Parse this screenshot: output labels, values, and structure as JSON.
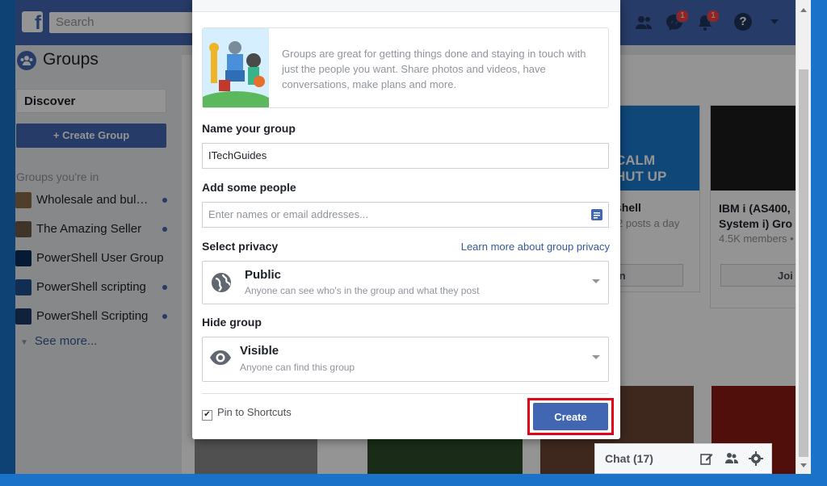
{
  "header": {
    "logo_letter": "f",
    "search_placeholder": "Search",
    "messages_badge": "1",
    "notifications_badge": "1",
    "help_glyph": "?"
  },
  "left": {
    "title": "Groups",
    "discover": "Discover",
    "create_group": "+ Create Group",
    "groups_heading": "Groups you're in",
    "groups": [
      {
        "label": "Wholesale and bulk ..."
      },
      {
        "label": "The Amazing Seller"
      },
      {
        "label": "PowerShell User Group"
      },
      {
        "label": "PowerShell scripting"
      },
      {
        "label": "PowerShell Scripting"
      }
    ],
    "see_more": "See more..."
  },
  "background_cards": {
    "card1": {
      "title": "shell",
      "meta": "2 posts a day",
      "button": "in",
      "poster": "CALM\nHUT UP"
    },
    "card2": {
      "title": "IBM i (AS400, System i) Gro",
      "meta": "4.5K members •",
      "button": "Joi"
    }
  },
  "dialog": {
    "intro": "Groups are great for getting things done and staying in touch with just the people you want. Share photos and videos, have conversations, make plans and more.",
    "name_label": "Name your group",
    "name_value": "ITechGuides",
    "people_label": "Add some people",
    "people_placeholder": "Enter names or email addresses...",
    "privacy_label": "Select privacy",
    "privacy_link": "Learn more about group privacy",
    "privacy_title": "Public",
    "privacy_sub": "Anyone can see who's in the group and what they post",
    "hide_label": "Hide group",
    "hide_title": "Visible",
    "hide_sub": "Anyone can find this group",
    "pin_label": "Pin to Shortcuts",
    "pin_checked": "✔",
    "create": "Create"
  },
  "chat": {
    "label": "Chat (17)"
  },
  "colors": {
    "brand": "#4267b2",
    "highlight": "#e0001a"
  }
}
